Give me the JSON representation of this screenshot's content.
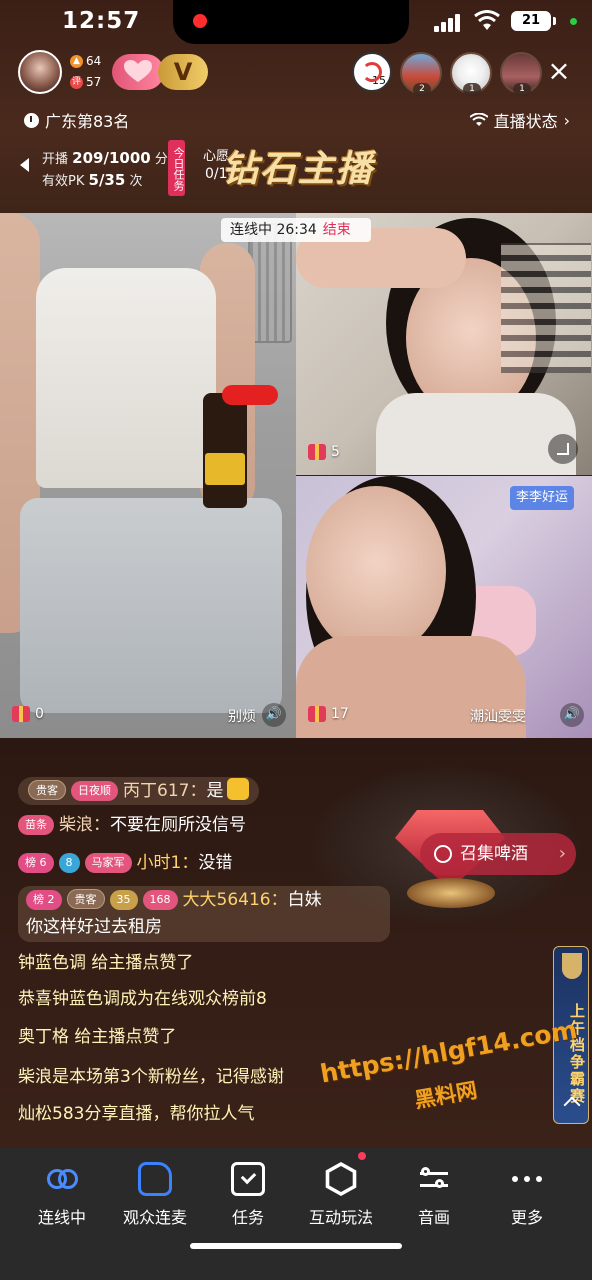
{
  "status_bar": {
    "time": "12:57",
    "battery": "21"
  },
  "header": {
    "host_stats": [
      {
        "icon": "flame-icon",
        "value": "64",
        "color": "#f0932b"
      },
      {
        "icon": "review-icon",
        "label": "评",
        "value": "57",
        "color": "#e84a4a"
      }
    ],
    "v_badge": "V",
    "viewer_count": "15",
    "viewers": [
      {
        "count": "2"
      },
      {
        "count": "1"
      },
      {
        "count": "1"
      }
    ],
    "close_icon": "×"
  },
  "rank_text": "广东第83名",
  "live_status": "直播状态",
  "tasks": {
    "line1_label": "开播",
    "line1_value": "209/1000",
    "line1_unit": "分钟",
    "line2_label": "有效PK",
    "line2_value": "5/35",
    "line2_unit": "次",
    "today_task": "今日任务",
    "wish_label": "心愿",
    "wish_progress": "0/10",
    "diamond_title": "钻石主播"
  },
  "connect_bar": {
    "label": "连线中 26:34",
    "end": "结束"
  },
  "videos": {
    "left": {
      "gifts": "0",
      "label": "别烦"
    },
    "right_top": {
      "gifts": "5"
    },
    "right_bottom": {
      "gifts": "17",
      "label": "潮汕雯雯",
      "name_tag": "李李好运"
    }
  },
  "chat": [
    {
      "badges": [
        "贵客",
        "日夜顺"
      ],
      "user": "丙丁617：",
      "text": "是"
    },
    {
      "badges": [
        "苗条"
      ],
      "user": "柴浪：",
      "text": "不要在厕所没信号"
    },
    {
      "badges": [
        "榜 6",
        "8",
        "马家军"
      ],
      "user": "小时1：",
      "text": "没错"
    },
    {
      "badges": [
        "榜 2",
        "贵客",
        "35",
        "168"
      ],
      "user": "大大56416：",
      "text": "白妹",
      "text2": "你这样好过去租房"
    }
  ],
  "system_msgs": [
    "钟蓝色调 给主播点赞了",
    "恭喜钟蓝色调成为在线观众榜前8",
    "奥丁格 给主播点赞了",
    "柴浪是本场第3个新粉丝，记得感谢",
    "灿松583分享直播，帮你拉人气"
  ],
  "beer_button": "召集啤酒",
  "competition_badge": "上午档争霸赛",
  "watermark": {
    "url": "https://hlgf14.com",
    "name": "黑料网"
  },
  "bottom_nav": [
    {
      "label": "连线中",
      "icon": "link-icon"
    },
    {
      "label": "观众连麦",
      "icon": "phone-mic-icon"
    },
    {
      "label": "任务",
      "icon": "task-icon"
    },
    {
      "label": "互动玩法",
      "icon": "interact-icon"
    },
    {
      "label": "音画",
      "icon": "sliders-icon"
    },
    {
      "label": "更多",
      "icon": "more-icon"
    }
  ]
}
